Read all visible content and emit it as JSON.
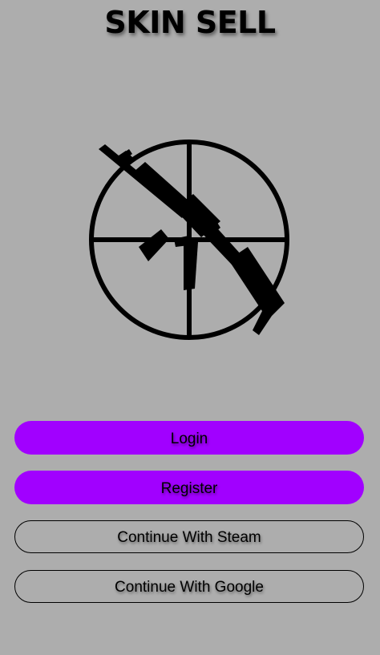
{
  "app": {
    "title": "SKIN SELL"
  },
  "logo": {
    "icon": "crosshair-rifle-icon"
  },
  "buttons": {
    "login_label": "Login",
    "register_label": "Register",
    "steam_label": "Continue With Steam",
    "google_label": "Continue With Google"
  },
  "colors": {
    "background": "#adadad",
    "primary": "#a100ff",
    "text": "#000000"
  }
}
